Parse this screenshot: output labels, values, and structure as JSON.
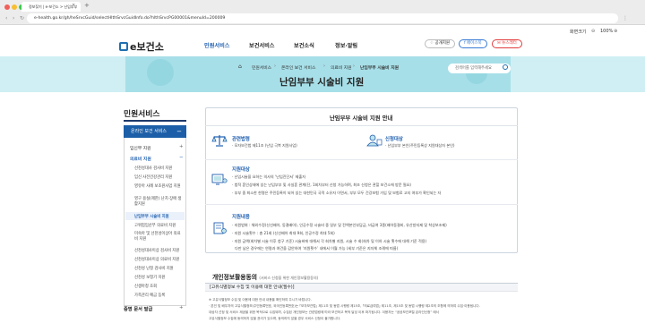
{
  "browser": {
    "tab_title": "정보찾기 | e-보건소 > 난임부부",
    "address": "e-health.go.kr/gh/heSrvcGuid/selectHlthSrvcGuidInfo.do?hlthSrvcPG00001&menuId=200009"
  },
  "util": {
    "sitemap": "화면크기",
    "zoom": "100%"
  },
  "header": {
    "logo": "e보건소",
    "nav": [
      "민원서비스",
      "보건서비스",
      "보건소식",
      "정보·알림"
    ],
    "pills": [
      "공개지원",
      "페이스북",
      "뉴스레터"
    ]
  },
  "banner": {
    "breadcrumb": [
      "민원서비스",
      "온라인 보건 서비스",
      "의료비 지원",
      "난임부부 시술비 지원"
    ],
    "title": "난임부부 시술비 지원",
    "search_placeholder": "검색어를 입력해주세요"
  },
  "lnb": {
    "title": "민원서비스",
    "head": "온라인 보건 서비스",
    "level2": [
      {
        "label": "임신부 지원",
        "active": false
      },
      {
        "label": "의료비 지원",
        "active": true
      }
    ],
    "level3": [
      {
        "label": "선천성대사 검사비 지원",
        "active": false
      },
      {
        "label": "임신 사전건강관리 지원",
        "active": false
      },
      {
        "label": "영유아 사례 보조원사업 지원",
        "active": false
      },
      {
        "label": "영구 용실(제한) 난치·장애 생활지원",
        "active": false
      },
      {
        "label": "난임부부 시술비 지원",
        "active": true
      },
      {
        "label": "고위험임산부 의료비 지원",
        "active": false
      },
      {
        "label": "미숙아 및 선천성이상아 의료비 지원",
        "active": false
      },
      {
        "label": "선천성대사이상 검사비 지원",
        "active": false
      },
      {
        "label": "선천성대사이상 의료비 지원",
        "active": false
      },
      {
        "label": "선천성 난청 검사비 지원",
        "active": false
      },
      {
        "label": "선천성 보청기 지원",
        "active": false
      },
      {
        "label": "신생아청 조회",
        "active": false
      },
      {
        "label": "가족관리 예금 등록",
        "active": false
      }
    ],
    "footer": "증명 문서 발급"
  },
  "content": {
    "title": "난임부부 시술비 지원 안내",
    "sections": [
      {
        "heading": "관련법령",
        "items": [
          "모자보건법 제11조 (난임 극복 지원사업)"
        ]
      },
      {
        "heading": "신청대상",
        "items": [
          "난임부부 본인(주민등록상 지원대상자 본인)"
        ]
      },
      {
        "heading": "지원대상",
        "items": [
          "난임시술을 요하는 의사의 ‘난임진단서’ 제출자",
          "법적 혼인상태에 있는 난임부부 및 사실혼 관계(단, 1회차부터 신청 가능하며, 최초 신청은 관할 보건소에 방문 필요)",
          "부부 중 최소한 한명은 주민등록이 되어 있는 대한민국 국적 소유자 이면서, 부부 모두 건강보험 가입 및 보험료 고지 여부가 확인되는 자"
        ]
      },
      {
        "heading": "지원내용",
        "items": [
          "지원범위 : 체외수정(신선배아, 동결배아), 인공수정 시술비 중 일부 및 전액본인부담금, 비급여 3종(배아동결비, 유산방지제 및 착상보조제)",
          "지원 시술횟수 : 총 21회 (신선배아 최대 9회, 인공수정 최대 5회)",
          "지원 금액(회차별 시술 이후 청구 기준) 시술비에 대해서 각 회차별 지원, 시술 수 회(회차 및 이하 시술 횟수에 대해 기준 적용)",
          "다만 남은 경우에는 연령과 여건을 감안하여 ‘지원횟수’ 내에서 이월 가능 (세부 기준은 지자체 조례에 따름)"
        ]
      }
    ]
  },
  "privacy": {
    "title": "개인정보활용동의",
    "note": "(서비스 신청을 위한 개인정보활용동의)",
    "bar": "[고유식별정보 수집 및 이용에 대한 안내(필수)]",
    "body": [
      "※ 고유식별정보 수집 및 이용에 대한 안내 내용을 확인하여 주시기 바랍니다.",
      "· 본인 및 배우자의 고유식별정보(주민등록번호, 외국인등록번호)는 ｢모자보건법｣ 제11조 및 동법 시행령 제15조, ｢의료급여법｣ 제11조, 제15조 및 동법 시행령 제2조의 조항에 의하여 수집·이용됩니다.",
      "대상자 선정 및 서비스 제공을 위한 목적으로 수집되며, 수집된 개인정보는 관련법령에 따라 보관하고 목적 달성 이후 파기됩니다. 이용자는 “공공보건포털 온라인신청” 에서",
      "고유식별정보 수집에 동의하지 않을 권리가 있으며, 동의하지 않을 경우 서비스 신청이 불가합니다."
    ]
  },
  "colors": {
    "accent": "#1f5fb0",
    "lnb_head": "#1c5fa8",
    "banner": "#cfeff4"
  }
}
